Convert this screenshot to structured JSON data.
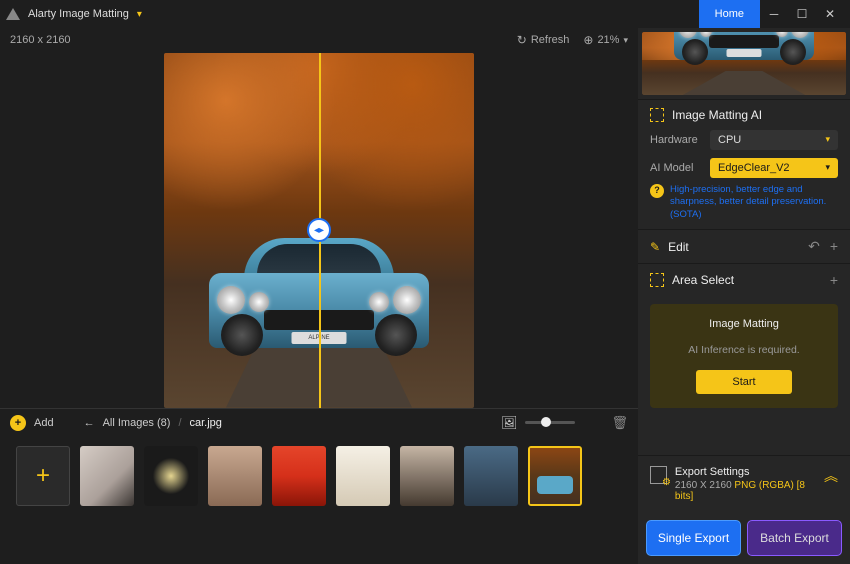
{
  "titlebar": {
    "app_name": "Alarty Image Matting",
    "home_label": "Home"
  },
  "viewer": {
    "dimensions": "2160 x 2160",
    "refresh_label": "Refresh",
    "zoom_label": "21%",
    "plate_text": "ALPINE"
  },
  "thumbs": {
    "add_label": "Add",
    "all_images_label": "All Images (8)",
    "current_file": "car.jpg"
  },
  "panels": {
    "matting_title": "Image Matting AI",
    "hardware_label": "Hardware",
    "hardware_value": "CPU",
    "model_label": "AI Model",
    "model_value": "EdgeClear_V2",
    "model_desc": "High-precision, better edge and sharpness, better detail preservation. (SOTA)",
    "edit_title": "Edit",
    "area_title": "Area Select"
  },
  "popup": {
    "title": "Image Matting",
    "message": "AI Inference is required.",
    "start_label": "Start"
  },
  "export": {
    "settings_title": "Export Settings",
    "dimensions": "2160 X 2160",
    "format": "PNG (RGBA) [8 bits]",
    "single_label": "Single Export",
    "batch_label": "Batch Export"
  }
}
